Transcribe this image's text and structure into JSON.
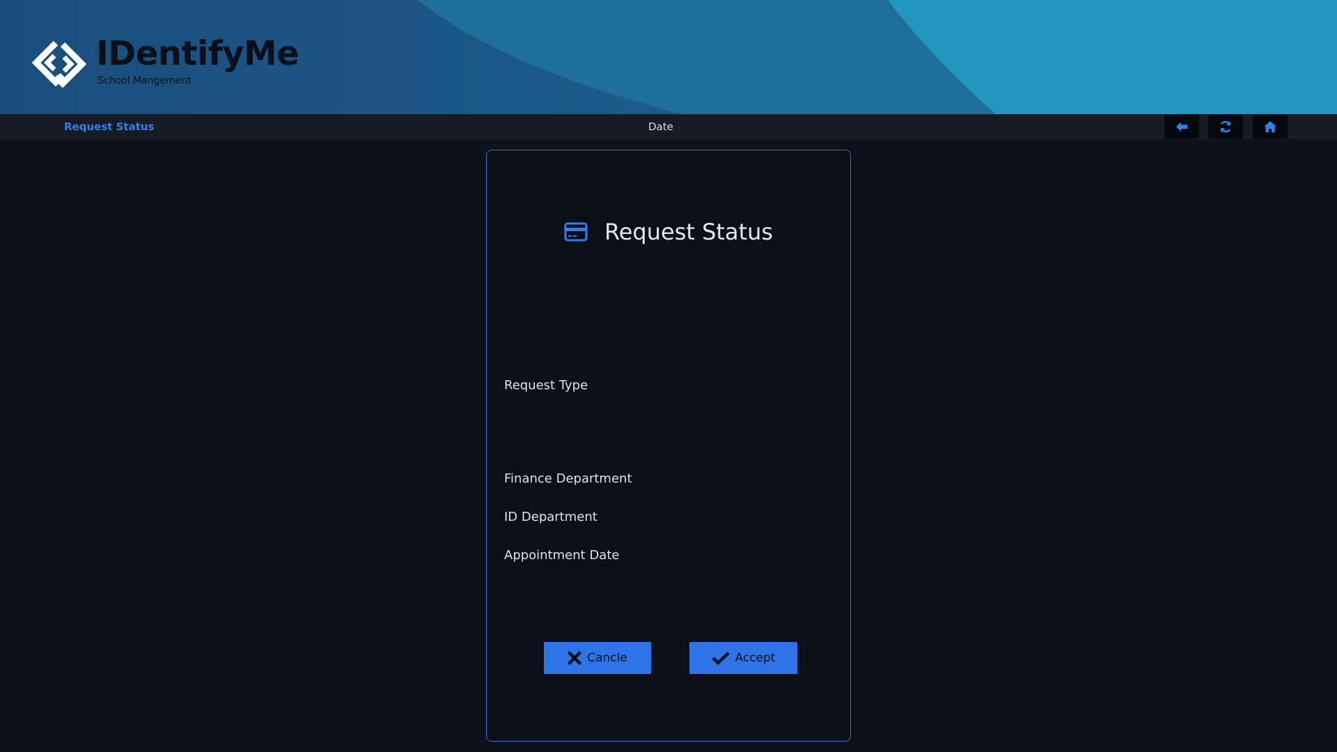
{
  "brand": {
    "title": "IDentifyMe",
    "subtitle": "School Mangement"
  },
  "navbar": {
    "page_title": "Request Status",
    "date_label": "Date",
    "buttons": [
      {
        "icon": "arrow-left-icon"
      },
      {
        "icon": "refresh-icon"
      },
      {
        "icon": "home-icon"
      }
    ]
  },
  "card": {
    "icon": "credit-card-icon",
    "title": "Request Status",
    "fields": {
      "request_type": "Request Type",
      "finance_department": "Finance Department",
      "id_department": "ID Department",
      "appointment_date": "Appointment Date"
    },
    "cancel_label": "Cancle",
    "accept_label": "Accept"
  },
  "colors": {
    "accent": "#2f80ed",
    "button": "#2e74e8",
    "background": "#0d111a",
    "header": "#1d5b8a"
  }
}
